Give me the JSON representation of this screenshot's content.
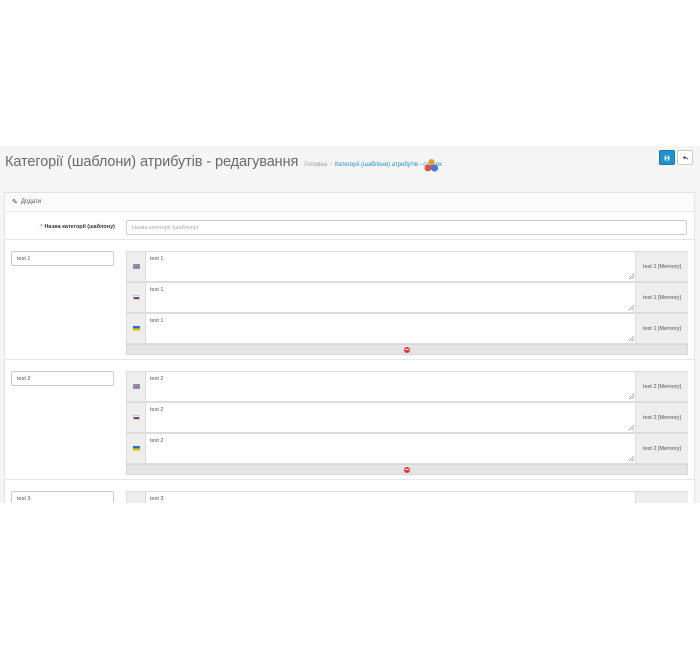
{
  "header": {
    "title": "Категорії (шаблони) атрибутів - редагування",
    "breadcrumb": [
      {
        "label": "Головна",
        "link": false
      },
      {
        "label": "Категорії (шаблони) атрибутів - список",
        "link": true
      }
    ],
    "breadcrumb_sep": "›",
    "save_icon": "save-icon",
    "back_icon": "reply-icon"
  },
  "panel": {
    "heading": "Додати",
    "heading_icon": "pencil-icon"
  },
  "form": {
    "name_label": "Назва категорії (шаблону)",
    "required_mark": "*",
    "name_placeholder": "Назва категорії (шаблону)"
  },
  "groups": [
    {
      "key": "test 1",
      "rows": [
        {
          "flag": "uk-flag-icon",
          "text": "test 1",
          "memory": "test 1 [Memory]"
        },
        {
          "flag": "ru-flag-icon",
          "text": "test 1",
          "memory": "test 1 [Memory]"
        },
        {
          "flag": "ua-flag-icon",
          "text": "test 1",
          "memory": "test 1 [Memory]"
        }
      ]
    },
    {
      "key": "test 2",
      "rows": [
        {
          "flag": "uk-flag-icon",
          "text": "test 2",
          "memory": "test 2 [Memory]"
        },
        {
          "flag": "ru-flag-icon",
          "text": "test 2",
          "memory": "test 2 [Memory]"
        },
        {
          "flag": "ua-flag-icon",
          "text": "test 2",
          "memory": "test 2 [Memory]"
        }
      ]
    },
    {
      "key": "test 3",
      "rows": [
        {
          "flag": "uk-flag-icon",
          "text": "test 3",
          "memory": ""
        }
      ]
    }
  ],
  "colors": {
    "primary": "#1e91cf",
    "danger": "#e3342f",
    "page_bg": "#f5f5f5"
  }
}
